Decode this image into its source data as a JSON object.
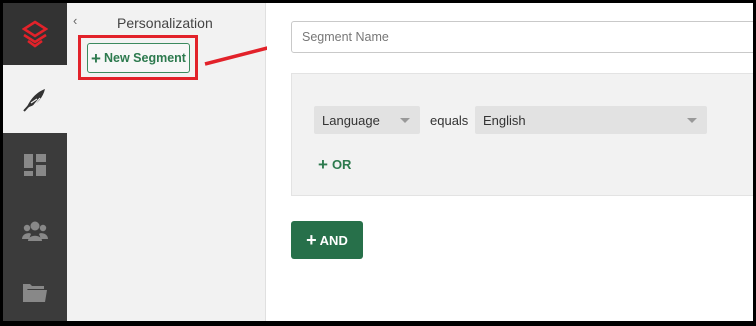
{
  "rail": {
    "items": [
      {
        "icon": "logo-icon"
      },
      {
        "icon": "feather-icon"
      },
      {
        "icon": "dashboard-icon"
      },
      {
        "icon": "users-icon"
      },
      {
        "icon": "folder-icon"
      }
    ],
    "active_index": 1
  },
  "sidebar": {
    "title": "Personalization",
    "collapse_glyph": "‹",
    "new_segment_label": "New Segment",
    "plus_glyph": "+"
  },
  "main": {
    "segment_name_placeholder": "Segment Name",
    "segment_name_value": "",
    "condition": {
      "field": "Language",
      "operator": "equals",
      "value": "English"
    },
    "or_label": "OR",
    "and_label": "AND"
  },
  "colors": {
    "brand_red": "#e2222a",
    "action_green": "#27704a",
    "rail_bg": "#3b3b3b"
  }
}
